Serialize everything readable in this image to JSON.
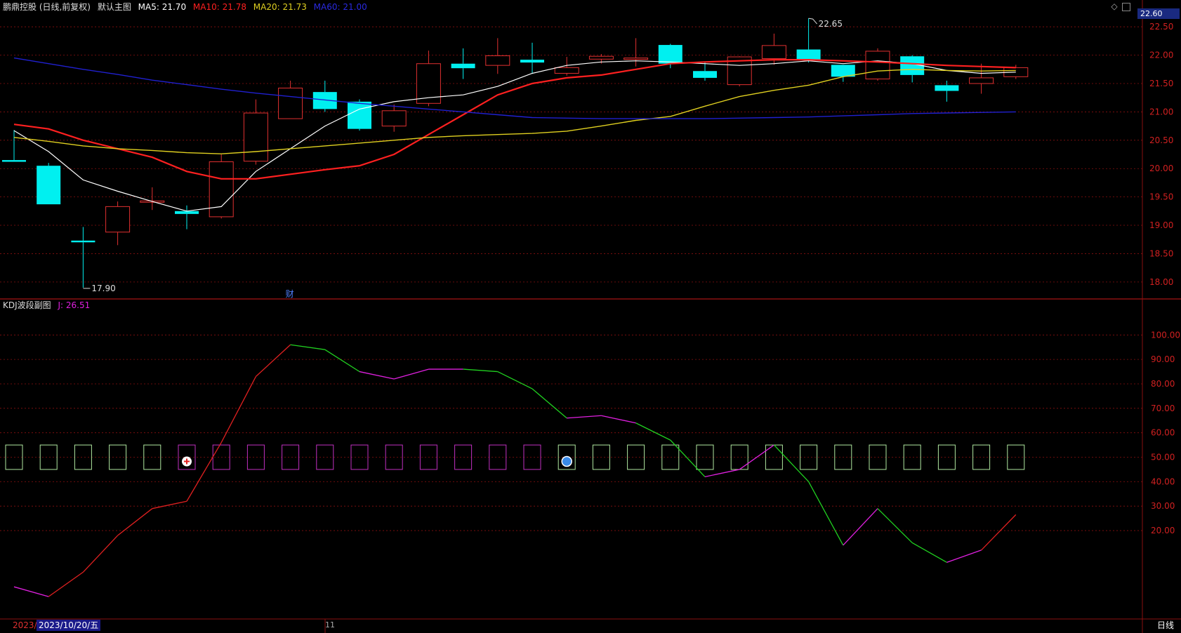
{
  "header": {
    "stock": "鹏鼎控股 (日线,前复权)",
    "main_chart": "默认主图",
    "ma5": "MA5: 21.70",
    "ma10": "MA10: 21.78",
    "ma20": "MA20: 21.73",
    "ma60": "MA60: 21.00",
    "current_price": "22.60"
  },
  "sub_header": {
    "indicator": "KDJ波段副图",
    "j_value": "J: 26.51"
  },
  "footer": {
    "year_prefix": "2023/",
    "date": "2023/10/20/五",
    "month_marker": "11",
    "period": "日线"
  },
  "colors": {
    "up": "#e03030",
    "down": "#00f0f0",
    "ma5": "#ffffff",
    "ma10": "#ff2020",
    "ma20": "#e0d020",
    "ma60": "#2020d0",
    "grid": "#8a1010",
    "kdj_up": "#e02020",
    "kdj_mid": "#e020e0",
    "kdj_down": "#20d020"
  },
  "chart_data": [
    {
      "type": "candlestick",
      "yticks": [
        "22.50",
        "22.00",
        "21.50",
        "21.00",
        "20.50",
        "20.00",
        "19.50",
        "19.00",
        "18.50",
        "18.00"
      ],
      "ylim": [
        17.8,
        22.75
      ],
      "annotations": {
        "high": "22.65",
        "low": "17.90",
        "event": "财"
      },
      "candles": [
        {
          "o": 20.15,
          "h": 20.68,
          "l": 20.12,
          "c": 20.12
        },
        {
          "o": 20.05,
          "h": 20.1,
          "l": 19.37,
          "c": 19.37
        },
        {
          "o": 18.73,
          "h": 18.97,
          "l": 17.9,
          "c": 18.7
        },
        {
          "o": 18.88,
          "h": 19.42,
          "l": 18.65,
          "c": 19.33
        },
        {
          "o": 19.43,
          "h": 19.67,
          "l": 19.27,
          "c": 19.43
        },
        {
          "o": 19.25,
          "h": 19.35,
          "l": 18.93,
          "c": 19.2
        },
        {
          "o": 19.15,
          "h": 20.25,
          "l": 19.12,
          "c": 20.12
        },
        {
          "o": 20.13,
          "h": 21.22,
          "l": 20.07,
          "c": 20.98
        },
        {
          "o": 20.88,
          "h": 21.55,
          "l": 20.88,
          "c": 21.42
        },
        {
          "o": 21.35,
          "h": 21.55,
          "l": 21.0,
          "c": 21.05
        },
        {
          "o": 21.18,
          "h": 21.22,
          "l": 20.67,
          "c": 20.7
        },
        {
          "o": 20.75,
          "h": 21.13,
          "l": 20.65,
          "c": 21.02
        },
        {
          "o": 21.15,
          "h": 22.08,
          "l": 21.1,
          "c": 21.85
        },
        {
          "o": 21.85,
          "h": 22.12,
          "l": 21.58,
          "c": 21.77
        },
        {
          "o": 21.82,
          "h": 22.3,
          "l": 21.67,
          "c": 21.99
        },
        {
          "o": 21.92,
          "h": 22.22,
          "l": 21.67,
          "c": 21.87
        },
        {
          "o": 21.68,
          "h": 21.97,
          "l": 21.64,
          "c": 21.78
        },
        {
          "o": 21.93,
          "h": 22.02,
          "l": 21.85,
          "c": 21.98
        },
        {
          "o": 21.94,
          "h": 22.3,
          "l": 21.8,
          "c": 21.95
        },
        {
          "o": 22.18,
          "h": 22.2,
          "l": 21.77,
          "c": 21.85
        },
        {
          "o": 21.72,
          "h": 21.88,
          "l": 21.55,
          "c": 21.6
        },
        {
          "o": 21.48,
          "h": 21.98,
          "l": 21.45,
          "c": 21.97
        },
        {
          "o": 21.94,
          "h": 22.38,
          "l": 21.83,
          "c": 22.17
        },
        {
          "o": 22.1,
          "h": 22.65,
          "l": 21.87,
          "c": 21.92
        },
        {
          "o": 21.83,
          "h": 21.83,
          "l": 21.53,
          "c": 21.62
        },
        {
          "o": 21.58,
          "h": 22.12,
          "l": 21.55,
          "c": 22.07
        },
        {
          "o": 21.98,
          "h": 22.0,
          "l": 21.52,
          "c": 21.65
        },
        {
          "o": 21.47,
          "h": 21.55,
          "l": 21.18,
          "c": 21.37
        },
        {
          "o": 21.5,
          "h": 21.85,
          "l": 21.32,
          "c": 21.6
        },
        {
          "o": 21.62,
          "h": 21.83,
          "l": 21.58,
          "c": 21.78
        }
      ],
      "ma": [
        {
          "name": "MA5",
          "values": [
            20.67,
            20.3,
            19.8,
            19.6,
            19.42,
            19.25,
            19.33,
            19.95,
            20.35,
            20.75,
            21.05,
            21.18,
            21.25,
            21.3,
            21.45,
            21.68,
            21.82,
            21.88,
            21.9,
            21.88,
            21.85,
            21.82,
            21.85,
            21.9,
            21.85,
            21.9,
            21.85,
            21.73,
            21.68,
            21.7
          ]
        },
        {
          "name": "MA10",
          "values": [
            20.78,
            20.7,
            20.5,
            20.35,
            20.2,
            19.95,
            19.82,
            19.82,
            19.9,
            19.98,
            20.05,
            20.25,
            20.6,
            20.95,
            21.3,
            21.5,
            21.6,
            21.65,
            21.75,
            21.85,
            21.88,
            21.9,
            21.92,
            21.92,
            21.9,
            21.88,
            21.85,
            21.82,
            21.8,
            21.78
          ]
        },
        {
          "name": "MA20",
          "values": [
            20.55,
            20.48,
            20.4,
            20.35,
            20.32,
            20.28,
            20.26,
            20.3,
            20.35,
            20.4,
            20.45,
            20.5,
            20.55,
            20.58,
            20.6,
            20.62,
            20.66,
            20.75,
            20.85,
            20.92,
            21.1,
            21.27,
            21.38,
            21.47,
            21.62,
            21.72,
            21.75,
            21.73,
            21.72,
            21.73
          ]
        },
        {
          "name": "MA60",
          "values": [
            21.95,
            21.85,
            21.75,
            21.66,
            21.56,
            21.48,
            21.4,
            21.33,
            21.27,
            21.21,
            21.15,
            21.1,
            21.05,
            21.0,
            20.95,
            20.9,
            20.89,
            20.88,
            20.88,
            20.88,
            20.88,
            20.89,
            20.9,
            20.91,
            20.93,
            20.95,
            20.97,
            20.98,
            20.99,
            21.0
          ]
        }
      ]
    },
    {
      "type": "line",
      "yticks": [
        "100.00",
        "90.00",
        "80.00",
        "70.00",
        "60.00",
        "50.00",
        "40.00",
        "30.00",
        "20.00"
      ],
      "ylim": [
        -15,
        113
      ],
      "j_values": [
        -3,
        -7,
        3,
        18,
        29,
        32,
        56,
        83,
        96,
        94,
        85,
        82,
        86,
        86,
        85,
        78,
        66,
        67,
        64,
        57,
        42,
        45,
        55,
        40,
        14,
        29,
        15,
        7,
        12,
        26.51
      ],
      "segment_colors": [
        "down",
        "mid",
        "up",
        "up",
        "up",
        "up",
        "up",
        "up",
        "up",
        "down",
        "down",
        "mid",
        "mid",
        "mid",
        "down",
        "down",
        "down",
        "mid",
        "mid",
        "down",
        "down",
        "mid",
        "mid",
        "down",
        "down",
        "mid",
        "down",
        "down",
        "mid",
        "up"
      ],
      "markers": [
        {
          "color": "down",
          "symbol": "none"
        },
        {
          "color": "down",
          "symbol": "none"
        },
        {
          "color": "down",
          "symbol": "none"
        },
        {
          "color": "down",
          "symbol": "none"
        },
        {
          "color": "down",
          "symbol": "none"
        },
        {
          "color": "mid",
          "symbol": "plus"
        },
        {
          "color": "mid",
          "symbol": "none"
        },
        {
          "color": "mid",
          "symbol": "none"
        },
        {
          "color": "mid",
          "symbol": "none"
        },
        {
          "color": "mid",
          "symbol": "none"
        },
        {
          "color": "mid",
          "symbol": "none"
        },
        {
          "color": "mid",
          "symbol": "none"
        },
        {
          "color": "mid",
          "symbol": "none"
        },
        {
          "color": "mid",
          "symbol": "none"
        },
        {
          "color": "mid",
          "symbol": "none"
        },
        {
          "color": "mid",
          "symbol": "none"
        },
        {
          "color": "down",
          "symbol": "ball"
        },
        {
          "color": "down",
          "symbol": "none"
        },
        {
          "color": "down",
          "symbol": "none"
        },
        {
          "color": "down",
          "symbol": "none"
        },
        {
          "color": "down",
          "symbol": "none"
        },
        {
          "color": "down",
          "symbol": "none"
        },
        {
          "color": "down",
          "symbol": "none"
        },
        {
          "color": "down",
          "symbol": "none"
        },
        {
          "color": "down",
          "symbol": "none"
        },
        {
          "color": "down",
          "symbol": "none"
        },
        {
          "color": "down",
          "symbol": "none"
        },
        {
          "color": "down",
          "symbol": "none"
        },
        {
          "color": "down",
          "symbol": "none"
        },
        {
          "color": "down",
          "symbol": "none"
        }
      ]
    }
  ]
}
